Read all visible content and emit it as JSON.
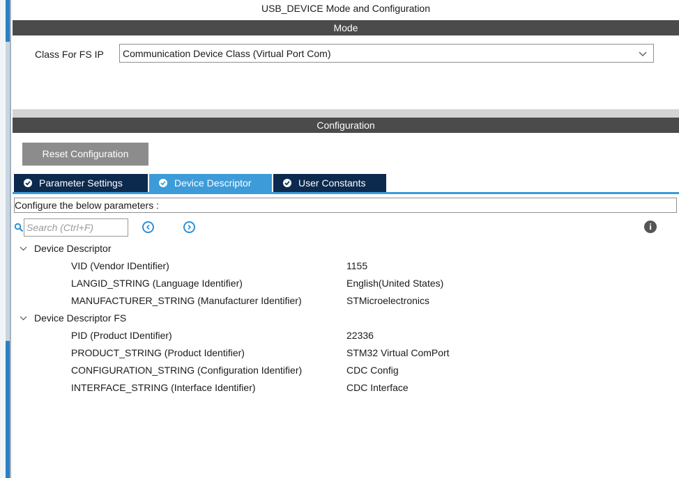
{
  "page": {
    "title": "USB_DEVICE Mode and Configuration"
  },
  "mode": {
    "header": "Mode",
    "class_label": "Class For FS IP",
    "class_value": "Communication Device Class (Virtual Port Com)"
  },
  "configuration": {
    "header": "Configuration",
    "reset_label": "Reset Configuration",
    "tabs": [
      {
        "label": "Parameter Settings",
        "active": false
      },
      {
        "label": "Device Descriptor",
        "active": true
      },
      {
        "label": "User Constants",
        "active": false
      }
    ],
    "hint": "Configure the below parameters :",
    "search_placeholder": "Search (Ctrl+F)"
  },
  "tree": {
    "groups": [
      {
        "label": "Device Descriptor",
        "rows": [
          {
            "name": "VID (Vendor IDentifier)",
            "value": "1155"
          },
          {
            "name": "LANGID_STRING (Language Identifier)",
            "value": "English(United States)"
          },
          {
            "name": "MANUFACTURER_STRING (Manufacturer Identifier)",
            "value": "STMicroelectronics"
          }
        ]
      },
      {
        "label": "Device Descriptor FS",
        "rows": [
          {
            "name": "PID (Product IDentifier)",
            "value": "22336"
          },
          {
            "name": "PRODUCT_STRING (Product Identifier)",
            "value": "STM32 Virtual ComPort"
          },
          {
            "name": "CONFIGURATION_STRING (Configuration Identifier)",
            "value": "CDC Config"
          },
          {
            "name": "INTERFACE_STRING (Interface Identifier)",
            "value": "CDC Interface"
          }
        ]
      }
    ]
  },
  "colors": {
    "header_bg": "#4b4b4b",
    "tab_bg": "#0c2a4e",
    "tab_active_bg": "#3c9bd8",
    "reset_button_bg": "#8c8c8c",
    "nav_icon": "#2f8fd6"
  },
  "icons": {
    "dropdown": "chevron-down-icon",
    "tab_status": "check-circle-icon",
    "search": "search-icon",
    "previous": "circle-chevron-left-icon",
    "next": "circle-chevron-right-icon",
    "info": "info-icon",
    "expander": "chevron-down-icon"
  }
}
